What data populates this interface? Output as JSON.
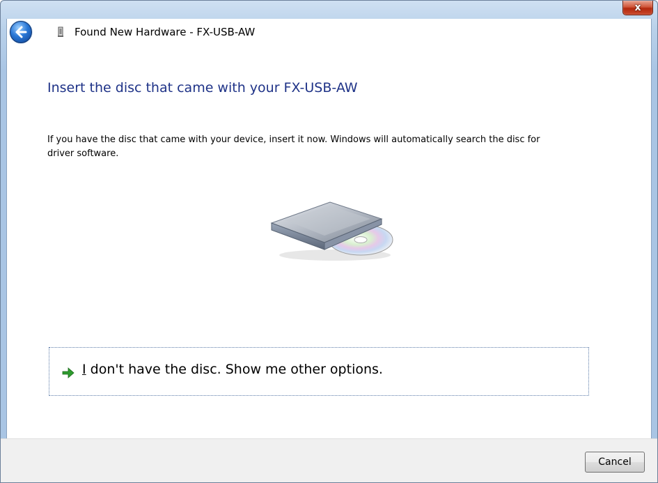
{
  "window": {
    "title": "Found New Hardware - FX-USB-AW",
    "close_label": "x"
  },
  "content": {
    "heading": "Insert the disc that came with your FX-USB-AW",
    "description": "If you have the disc that came with your device, insert it now.  Windows will automatically search the disc for driver software."
  },
  "option": {
    "accel": "I",
    "label_rest": " don't have the disc.  Show me other options."
  },
  "footer": {
    "cancel_label": "Cancel"
  },
  "icons": {
    "back": "back-arrow-icon",
    "hardware": "usb-device-icon",
    "option_arrow": "green-arrow-icon",
    "illustration": "disc-drive-illustration"
  },
  "colors": {
    "heading": "#1e3287",
    "close_button": "#c94a2d",
    "option_arrow": "#2e9b2e"
  }
}
